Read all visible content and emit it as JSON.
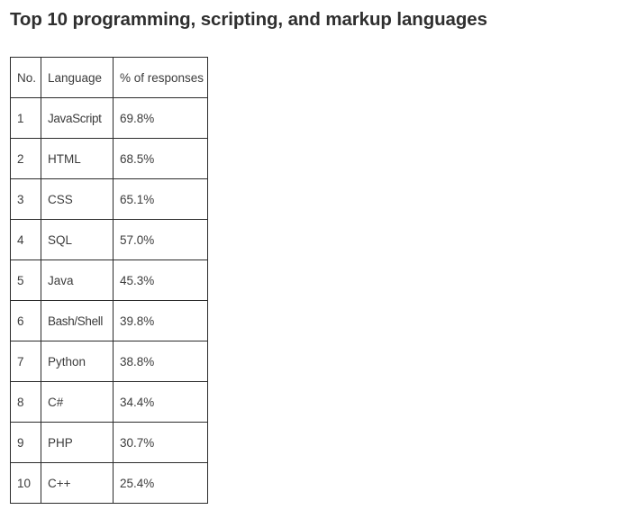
{
  "page": {
    "title": "Top 10 programming, scripting, and markup languages",
    "background_color": "#ffffff",
    "text_color": "#3c3c3c",
    "title_color": "#2f2f2f",
    "border_color": "#2b2b2b"
  },
  "chart_data": {
    "type": "table",
    "title": "Top 10 programming, scripting, and markup languages",
    "xlabel": "",
    "ylabel": "% of responses",
    "columns": [
      "No.",
      "Language",
      "% of responses"
    ],
    "categories": [
      "JavaScript",
      "HTML",
      "CSS",
      "SQL",
      "Java",
      "Bash/Shell",
      "Python",
      "C#",
      "PHP",
      "C++"
    ],
    "values": [
      69.8,
      68.5,
      65.1,
      57.0,
      45.3,
      39.8,
      38.8,
      34.4,
      30.7,
      25.4
    ],
    "rows": [
      {
        "no": "1",
        "language": "JavaScript",
        "percent": "69.8%"
      },
      {
        "no": "2",
        "language": "HTML",
        "percent": "68.5%"
      },
      {
        "no": "3",
        "language": "CSS",
        "percent": "65.1%"
      },
      {
        "no": "4",
        "language": "SQL",
        "percent": "57.0%"
      },
      {
        "no": "5",
        "language": "Java",
        "percent": "45.3%"
      },
      {
        "no": "6",
        "language": "Bash/Shell",
        "percent": "39.8%"
      },
      {
        "no": "7",
        "language": "Python",
        "percent": "38.8%"
      },
      {
        "no": "8",
        "language": "C#",
        "percent": "34.4%"
      },
      {
        "no": "9",
        "language": "PHP",
        "percent": "30.7%"
      },
      {
        "no": "10",
        "language": "C++",
        "percent": "25.4%"
      }
    ]
  }
}
